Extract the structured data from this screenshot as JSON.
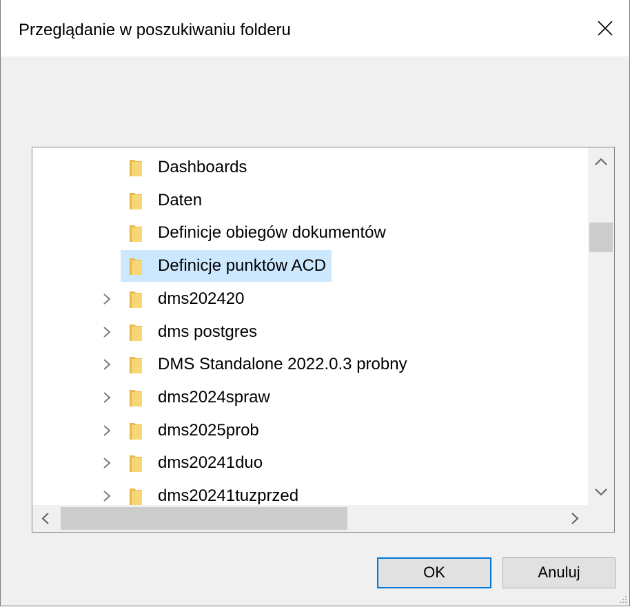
{
  "dialog": {
    "title": "Przeglądanie w poszukiwaniu folderu",
    "close_icon": "close-icon"
  },
  "tree": {
    "items": [
      {
        "label": "Dashboards",
        "expandable": false,
        "selected": false
      },
      {
        "label": "Daten",
        "expandable": false,
        "selected": false
      },
      {
        "label": "Definicje obiegów dokumentów",
        "expandable": false,
        "selected": false
      },
      {
        "label": "Definicje punktów ACD",
        "expandable": false,
        "selected": true
      },
      {
        "label": "dms202420",
        "expandable": true,
        "selected": false
      },
      {
        "label": "dms postgres",
        "expandable": true,
        "selected": false
      },
      {
        "label": "DMS Standalone 2022.0.3 probny",
        "expandable": true,
        "selected": false
      },
      {
        "label": "dms2024spraw",
        "expandable": true,
        "selected": false
      },
      {
        "label": "dms2025prob",
        "expandable": true,
        "selected": false
      },
      {
        "label": "dms20241duo",
        "expandable": true,
        "selected": false
      },
      {
        "label": "dms20241tuzprzed",
        "expandable": true,
        "selected": false
      }
    ],
    "folder_color": "#f8d775",
    "selection_color": "#cce8ff"
  },
  "buttons": {
    "ok_label": "OK",
    "cancel_label": "Anuluj"
  },
  "colors": {
    "accent": "#0078d7",
    "dialog_bg": "#f0f0f0"
  }
}
